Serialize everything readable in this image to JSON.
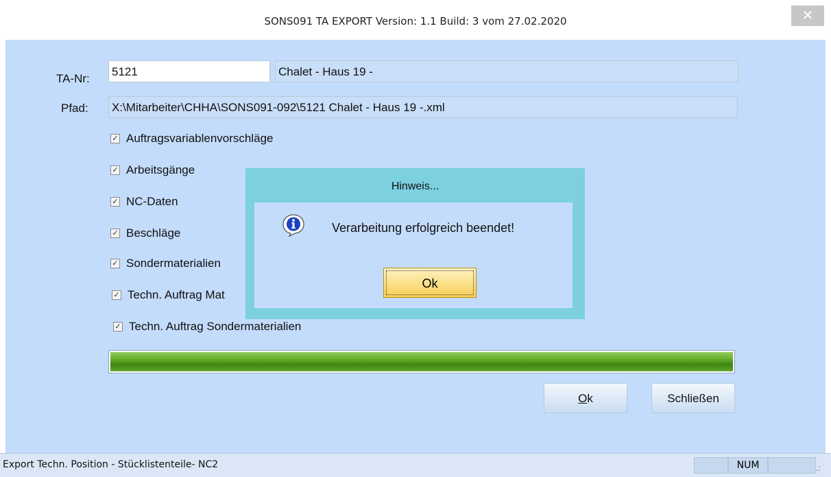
{
  "window": {
    "title": "SONS091 TA EXPORT Version: 1.1 Build: 3 vom 27.02.2020",
    "close_glyph": "✕"
  },
  "form": {
    "ta_label": "TA-Nr:",
    "ta_value": "5121",
    "ta_name": "Chalet - Haus 19 -",
    "path_label": "Pfad:",
    "path_value": "X:\\Mitarbeiter\\CHHA\\SONS091-092\\5121 Chalet - Haus 19 -.xml"
  },
  "options": [
    {
      "label": "Auftragsvariablenvorschläge",
      "checked": true
    },
    {
      "label": "Arbeitsgänge",
      "checked": true
    },
    {
      "label": "NC-Daten",
      "checked": true
    },
    {
      "label": "Beschläge",
      "checked": true
    },
    {
      "label": "Sondermaterialien",
      "checked": true
    },
    {
      "label": "Techn. Auftrag Mat",
      "checked": true
    },
    {
      "label": "Techn. Auftrag Sondermaterialien",
      "checked": true
    }
  ],
  "progress": {
    "value": 1.0,
    "color": "#4f9a1e"
  },
  "buttons": {
    "ok_prefix": "O",
    "ok_rest": "k",
    "close": "Schließen"
  },
  "statusbar": {
    "text": "Export Techn. Position - Stücklistenteile- NC2",
    "num": "NUM"
  },
  "dialog": {
    "title": "Hinweis...",
    "message": "Verarbeitung erfolgreich beendet!",
    "ok": "Ok",
    "icon": "info-icon"
  },
  "colors": {
    "client_bg": "#c4dcfb",
    "dialog_frame": "#7cd0df",
    "ok_button": "#f7cf55"
  }
}
